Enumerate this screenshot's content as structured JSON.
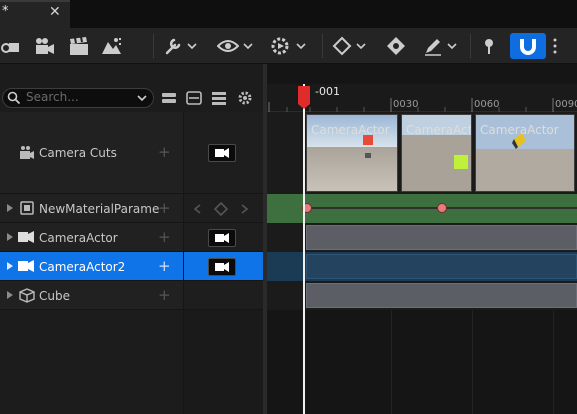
{
  "tab": {
    "title": "*",
    "close": "✕"
  },
  "search": {
    "placeholder": "Search..."
  },
  "tracks": [
    {
      "label": "Camera Cuts"
    },
    {
      "label": "NewMaterialParame"
    },
    {
      "label": "CameraActor"
    },
    {
      "label": "CameraActor2"
    },
    {
      "label": "Cube"
    }
  ],
  "timeline": {
    "playhead_frame": "-001",
    "ticks": [
      "0030",
      "0060",
      "0090"
    ]
  },
  "clips": [
    {
      "label": "CameraActor"
    },
    {
      "label": "CameraAct"
    },
    {
      "label": "CameraActor"
    }
  ],
  "icons": {
    "toolbar": [
      "camera-rig-icon",
      "movie-camera-icon",
      "clapperboard-icon",
      "render-icon",
      "wrench-icon",
      "eye-icon",
      "play-settings-icon",
      "keyframe-icon",
      "key-icon",
      "pen-icon",
      "pin-icon",
      "magnet-icon",
      "more-icon"
    ],
    "tracks": [
      "camera-cuts-icon",
      "material-icon",
      "camera-icon",
      "camera-icon",
      "cube-icon"
    ]
  },
  "colors": {
    "accent": "#0e74e8",
    "playhead": "#e02b2b",
    "material_track": "#3e6f3e",
    "keyframe": "#e87b7b"
  }
}
